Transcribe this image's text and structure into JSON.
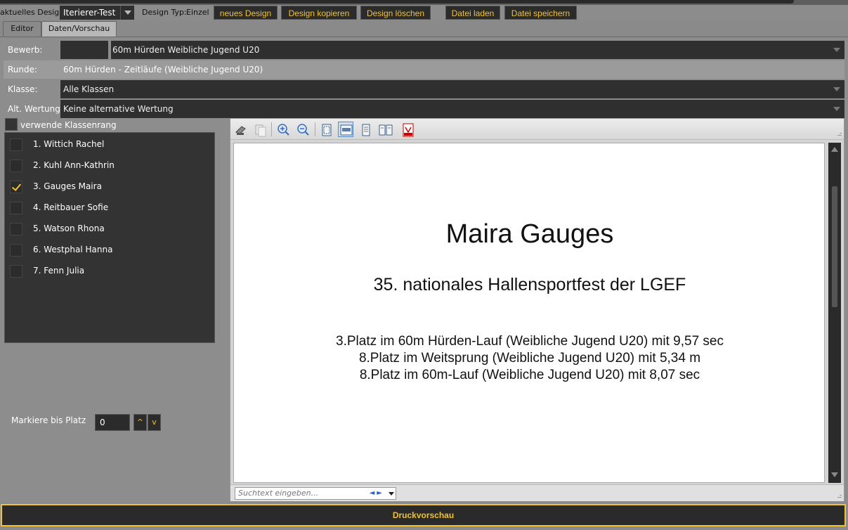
{
  "toolbar": {
    "current_design_label": "aktuelles Design",
    "current_design_value": "Iterierer-Test",
    "design_type_label": "Design Typ:",
    "design_type_value": "Einzel",
    "buttons": {
      "new": "neues Design",
      "copy": "Design kopieren",
      "delete": "Design löschen",
      "load": "Datei laden",
      "save": "Datei speichern"
    }
  },
  "tabs": {
    "editor": "Editor",
    "preview": "Daten/Vorschau"
  },
  "form": {
    "bewerb_label": "Bewerb:",
    "bewerb_value": "60m Hürden Weibliche Jugend U20",
    "runde_label": "Runde:",
    "runde_value": "60m Hürden - Zeitläufe (Weibliche Jugend U20)",
    "klasse_label": "Klasse:",
    "klasse_value": "Alle Klassen",
    "alt_label": "Alt. Wertung",
    "alt_value": "Keine alternative Wertung"
  },
  "klassenrang_label": "verwende Klassenrang",
  "athletes": [
    {
      "label": "1. Wittich Rachel",
      "checked": false
    },
    {
      "label": "2. Kuhl Ann-Kathrin",
      "checked": false
    },
    {
      "label": "3. Gauges Maira",
      "checked": true
    },
    {
      "label": "4. Reitbauer Sofie",
      "checked": false
    },
    {
      "label": "5. Watson Rhona",
      "checked": false
    },
    {
      "label": "6. Westphal Hanna",
      "checked": false
    },
    {
      "label": "7. Fenn Julia",
      "checked": false
    }
  ],
  "markiere": {
    "label": "Markiere bis Platz",
    "value": "0",
    "up": "^",
    "down": "v"
  },
  "preview": {
    "title": "Maira Gauges",
    "subtitle": "35. nationales Hallensportfest der LGEF",
    "lines": [
      "3.Platz im 60m Hürden-Lauf (Weibliche Jugend U20) mit 9,57 sec",
      "8.Platz im Weitsprung (Weibliche Jugend U20) mit 5,34 m",
      "8.Platz im 60m-Lauf (Weibliche Jugend U20) mit 8,07 sec"
    ],
    "search_placeholder": "Suchtext eingeben...",
    "toolbar_icons": [
      "print-icon",
      "copy-icon",
      "zoom-in-icon",
      "zoom-out-icon",
      "fit-page-icon",
      "page-width-icon",
      "single-page-icon",
      "two-pages-icon",
      "pdf-export-icon"
    ]
  },
  "druckvorschau": "Druckvorschau",
  "colors": {
    "accent": "#f1c232",
    "dark": "#2f2f2f",
    "frame": "#8d8d8d"
  }
}
